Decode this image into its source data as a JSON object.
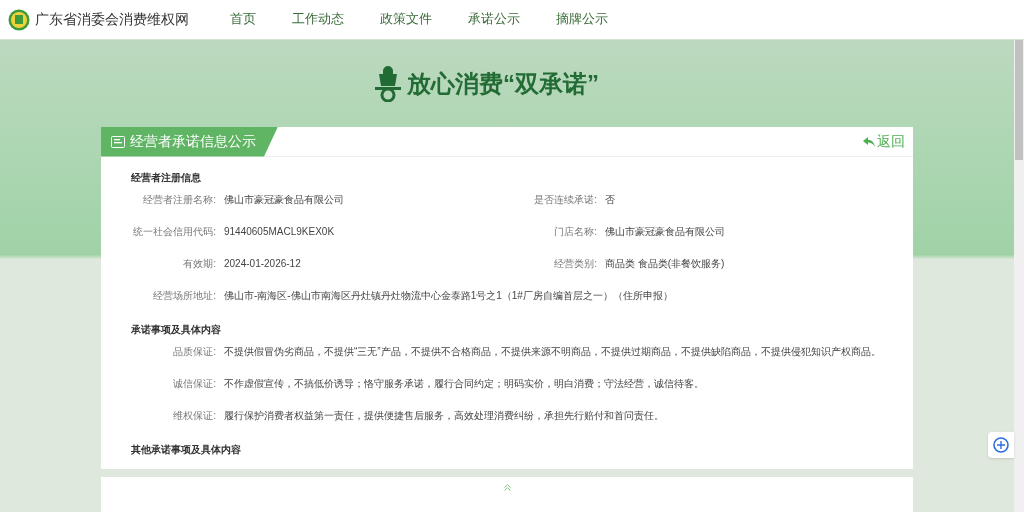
{
  "site": {
    "name": "广东省消委会消费维权网"
  },
  "nav": [
    {
      "label": "首页"
    },
    {
      "label": "工作动态"
    },
    {
      "label": "政策文件"
    },
    {
      "label": "承诺公示"
    },
    {
      "label": "摘牌公示"
    }
  ],
  "banner": {
    "title": "放心消费“双承诺”"
  },
  "card": {
    "title": "经营者承诺信息公示",
    "back": "返回",
    "sections": [
      {
        "heading": "经营者注册信息",
        "rows": [
          [
            {
              "label": "经营者注册名称:",
              "value": "佛山市豪冠豪食品有限公司"
            },
            {
              "label": "是否连续承诺:",
              "value": "否"
            }
          ],
          [
            {
              "label": "统一社会信用代码:",
              "value": "91440605MACL9KEX0K"
            },
            {
              "label": "门店名称:",
              "value": "佛山市豪冠豪食品有限公司"
            }
          ],
          [
            {
              "label": "有效期:",
              "value": "2024-01-2026-12"
            },
            {
              "label": "经营类别:",
              "value": "商品类 食品类(非餐饮服务)"
            }
          ],
          [
            {
              "label": "经营场所地址:",
              "value": "佛山市-南海区-佛山市南海区丹灶镇丹灶物流中心金泰路1号之1（1#厂房自编首层之一）（住所申报）"
            }
          ]
        ]
      },
      {
        "heading": "承诺事项及具体内容",
        "rows": [
          [
            {
              "label": "品质保证:",
              "value": "不提供假冒伪劣商品，不提供“三无”产品，不提供不合格商品，不提供来源不明商品，不提供过期商品，不提供缺陷商品，不提供侵犯知识产权商品。"
            }
          ],
          [
            {
              "label": "诚信保证:",
              "value": "不作虚假宣传，不搞低价诱导；恪守服务承诺，履行合同约定；明码实价，明白消费；守法经营，诚信待客。"
            }
          ],
          [
            {
              "label": "维权保证:",
              "value": "履行保护消费者权益第一责任，提供便捷售后服务，高效处理消费纠纷，承担先行赔付和首问责任。"
            }
          ]
        ]
      },
      {
        "heading": "其他承诺事项及具体内容"
      }
    ]
  }
}
